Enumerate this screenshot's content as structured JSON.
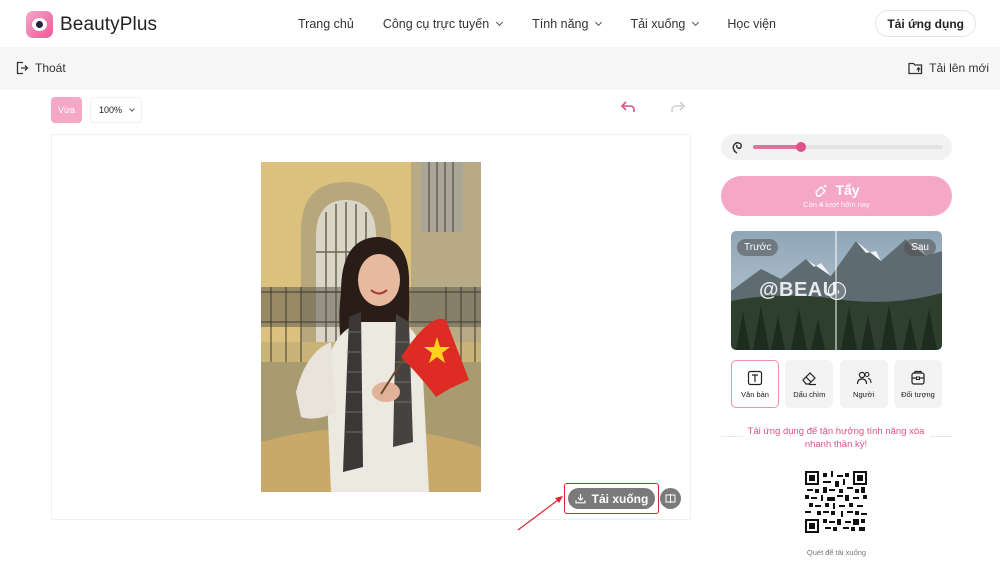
{
  "brand": {
    "name": "BeautyPlus"
  },
  "nav": {
    "links": [
      "Trang chủ",
      "Công cụ trực tuyến",
      "Tính năng",
      "Tải xuống",
      "Học viện"
    ],
    "app_button": "Tải ứng dụng"
  },
  "subbar": {
    "exit_label": "Thoát",
    "upload_label": "Tải lên mới"
  },
  "editor": {
    "fit_label": "Vừa",
    "zoom_value": "100%",
    "download_label": "Tải xuống"
  },
  "panel": {
    "brush_level": 0.25,
    "erase_label": "Tẩy",
    "remaining_prefix": "Còn ",
    "remaining_count": "4",
    "remaining_suffix": " lượt hôm nay",
    "before_label": "Trước",
    "after_label": "Sau",
    "watermark_text": "@BEAU",
    "tools": [
      {
        "label": "Văn bản",
        "icon": "text-icon",
        "active": true
      },
      {
        "label": "Dấu chìm",
        "icon": "eraser-icon",
        "active": false
      },
      {
        "label": "Người",
        "icon": "people-icon",
        "active": false
      },
      {
        "label": "Đối tượng",
        "icon": "object-icon",
        "active": false
      }
    ],
    "promo_text": "Tải ứng dụng để tận hưởng tính năng xóa nhanh thần kỳ!",
    "scan_label": "Quét để tải xuống"
  },
  "colors": {
    "accent": "#e2508a",
    "accent_light": "#f4a8c5",
    "highlight": "#d9272e"
  }
}
